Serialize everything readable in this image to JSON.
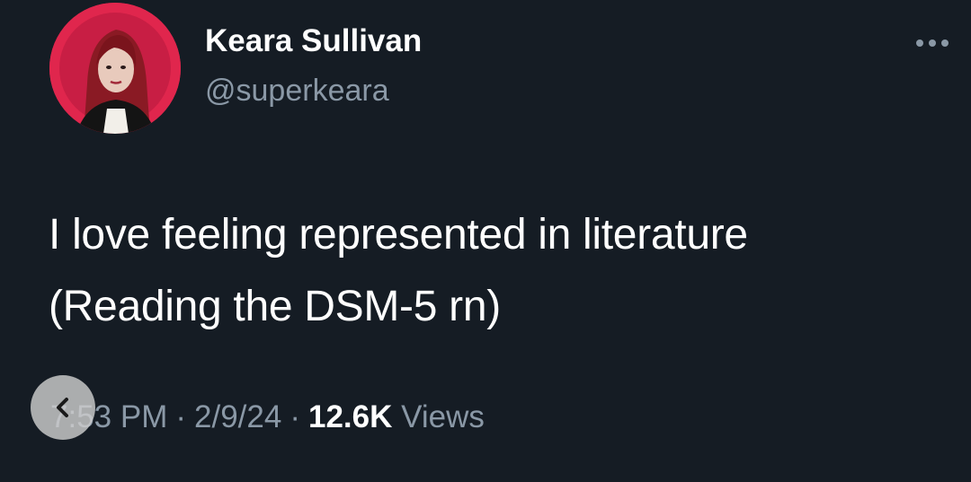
{
  "author": {
    "display_name": "Keara Sullivan",
    "handle": "@superkeara",
    "avatar_icon": "profile-photo"
  },
  "tweet": {
    "lines": [
      "I love feeling represented in literature",
      "(Reading the DSM-5 rn)"
    ]
  },
  "meta": {
    "time": "7:53 PM",
    "separator": "·",
    "date": "2/9/24",
    "views_count": "12.6K",
    "views_label": "Views"
  },
  "icons": {
    "more": "more-horizontal-icon",
    "back": "chevron-left-icon"
  },
  "colors": {
    "background": "#151c24",
    "secondary_text": "#8a98a6",
    "avatar_ring": "#e0264d"
  }
}
